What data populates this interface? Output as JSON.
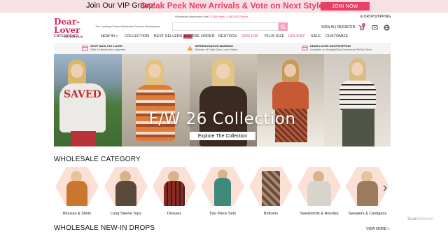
{
  "promo": {
    "prefix": "Join Our VIP Group!",
    "headline": "Sneak Peek New Arrivals & Vote on Next Styles",
    "join_label": "JOIN NOW"
  },
  "header": {
    "logo_text": "Dear-Lover",
    "logo_sub": "Wholesale",
    "tagline": "The Leading Online Wholesale Fashion Marketplace",
    "stats_prefix": "Wholesale warehouse total:",
    "stats_items": "5,583 Items",
    "stats_pieces": "4,582,562 Pieces",
    "signin_label": "SIGN IN | REGISTER",
    "dropshipping_label": "DROPSHIPPING",
    "search_placeholder": "",
    "cart_count": "0"
  },
  "nav": {
    "categories": "CATEGORIES",
    "new_in": "NEW IN",
    "collection": "COLLECTION",
    "best_sellers": "BEST SELLERS",
    "hot_badge": "HOT",
    "pre_order": "PRE ORDER",
    "restock": "RESTOCK",
    "fw": "2026 F/W",
    "plus_size": "PLUS SIZE",
    "holiday": "HOLIDAY",
    "sale": "SALE",
    "customize": "CUSTOMIZE"
  },
  "infobar": [
    {
      "title": "SHOP NOW, PAY LATER",
      "sub": "With 4 interest-free payment"
    },
    {
      "title": "IMPERSONATION WARNING",
      "sub": "Beware of Fake Dear-Lover Sales"
    },
    {
      "title": "DEAR-LOVER DROPSHIPPING",
      "sub": "Available on Shopify/WooCommerce/TikTok Store"
    }
  ],
  "banner": {
    "title": "F/W 26 Collection",
    "button": "Explore The Collection",
    "sweater_text": "SAVED"
  },
  "sections": {
    "wholesale_category": "WHOLESALE CATEGORY",
    "new_in_drops": "WHOLESALE NEW-IN DROPS",
    "view_more": "VIEW MORE >"
  },
  "categories": [
    {
      "label": "Blouses & Shirts",
      "tone": "#c9762f"
    },
    {
      "label": "Long Sleeve Tops",
      "tone": "#5a4a3a"
    },
    {
      "label": "Dresses",
      "tone": "#8b2a25"
    },
    {
      "label": "Two Piece Sets",
      "tone": "#3f8a7a"
    },
    {
      "label": "Bottoms",
      "tone": "#6b4a3a"
    },
    {
      "label": "Sweatshirts & Hoodies",
      "tone": "#d8d4cc"
    },
    {
      "label": "Sweaters & Cardigans",
      "tone": "#9a7b5e"
    }
  ],
  "watermark": {
    "brand": "Scan",
    "rest": "Malware"
  },
  "colors": {
    "accent": "#ea3e67",
    "nav_red": "#e53a63",
    "hex_bg": "#fbe0d6"
  }
}
